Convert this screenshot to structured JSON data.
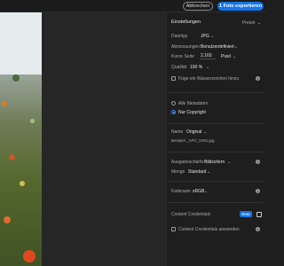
{
  "topbar": {
    "cancel_label": "Abbrechen",
    "export_label": "1 Foto exportieren"
  },
  "panel": {
    "title": "Einstellungen",
    "preset_label": "Preset",
    "filetype": {
      "label": "Dateityp",
      "value": "JPG"
    },
    "dimensions": {
      "label": "Abmessungen",
      "value": "Benutzerdefiniert"
    },
    "long_side": {
      "label": "Kurze Seite",
      "value": "2.160",
      "unit": "Pixel"
    },
    "quality": {
      "label": "Qualität",
      "value": "100 %"
    },
    "watermark": {
      "label": "Füge ein Wasserzeichen hinzu"
    },
    "metadata": {
      "all": "Alle Metadaten",
      "copyright": "Nur Copyright"
    },
    "name": {
      "label": "Name",
      "value": "Original",
      "example_label": "Beispiel",
      "example_value": "_APC_0491.jpg"
    },
    "sharpening": {
      "label": "Ausgabeschärfe",
      "value": "Bildschirm"
    },
    "amount": {
      "label": "Menge",
      "value": "Standard"
    },
    "colorspace": {
      "label": "Farbraum",
      "value": "sRGB"
    },
    "credentials": {
      "label": "Content Credentials",
      "beta": "Beta",
      "apply_label": "Content Credentials anwenden"
    }
  },
  "colors": {
    "accent": "#1473e6",
    "panel_bg": "#1e1e1e",
    "canvas_bg": "#262626"
  }
}
